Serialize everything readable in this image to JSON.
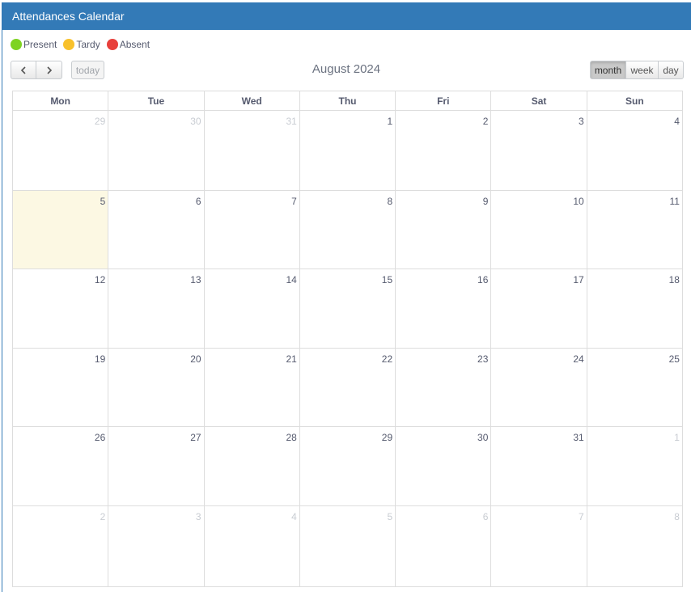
{
  "panel": {
    "title": "Attendances Calendar"
  },
  "legend": [
    {
      "label": "Present",
      "color": "#7ed321"
    },
    {
      "label": "Tardy",
      "color": "#f8c12c"
    },
    {
      "label": "Absent",
      "color": "#e8403b"
    }
  ],
  "toolbar": {
    "prev_icon": "chevron-left-icon",
    "next_icon": "chevron-right-icon",
    "today_label": "today",
    "title": "August 2024",
    "views": [
      "month",
      "week",
      "day"
    ],
    "active_view": "month"
  },
  "calendar": {
    "weekdays": [
      "Mon",
      "Tue",
      "Wed",
      "Thu",
      "Fri",
      "Sat",
      "Sun"
    ],
    "today": 5,
    "weeks": [
      [
        {
          "d": "29",
          "o": true
        },
        {
          "d": "30",
          "o": true
        },
        {
          "d": "31",
          "o": true
        },
        {
          "d": "1"
        },
        {
          "d": "2"
        },
        {
          "d": "3"
        },
        {
          "d": "4"
        }
      ],
      [
        {
          "d": "5",
          "t": true
        },
        {
          "d": "6"
        },
        {
          "d": "7"
        },
        {
          "d": "8"
        },
        {
          "d": "9"
        },
        {
          "d": "10"
        },
        {
          "d": "11"
        }
      ],
      [
        {
          "d": "12"
        },
        {
          "d": "13"
        },
        {
          "d": "14"
        },
        {
          "d": "15"
        },
        {
          "d": "16"
        },
        {
          "d": "17"
        },
        {
          "d": "18"
        }
      ],
      [
        {
          "d": "19"
        },
        {
          "d": "20"
        },
        {
          "d": "21"
        },
        {
          "d": "22"
        },
        {
          "d": "23"
        },
        {
          "d": "24"
        },
        {
          "d": "25"
        }
      ],
      [
        {
          "d": "26"
        },
        {
          "d": "27"
        },
        {
          "d": "28"
        },
        {
          "d": "29"
        },
        {
          "d": "30"
        },
        {
          "d": "31"
        },
        {
          "d": "1",
          "o": true
        }
      ],
      [
        {
          "d": "2",
          "o": true
        },
        {
          "d": "3",
          "o": true
        },
        {
          "d": "4",
          "o": true
        },
        {
          "d": "5",
          "o": true
        },
        {
          "d": "6",
          "o": true
        },
        {
          "d": "7",
          "o": true
        },
        {
          "d": "8",
          "o": true
        }
      ]
    ]
  }
}
